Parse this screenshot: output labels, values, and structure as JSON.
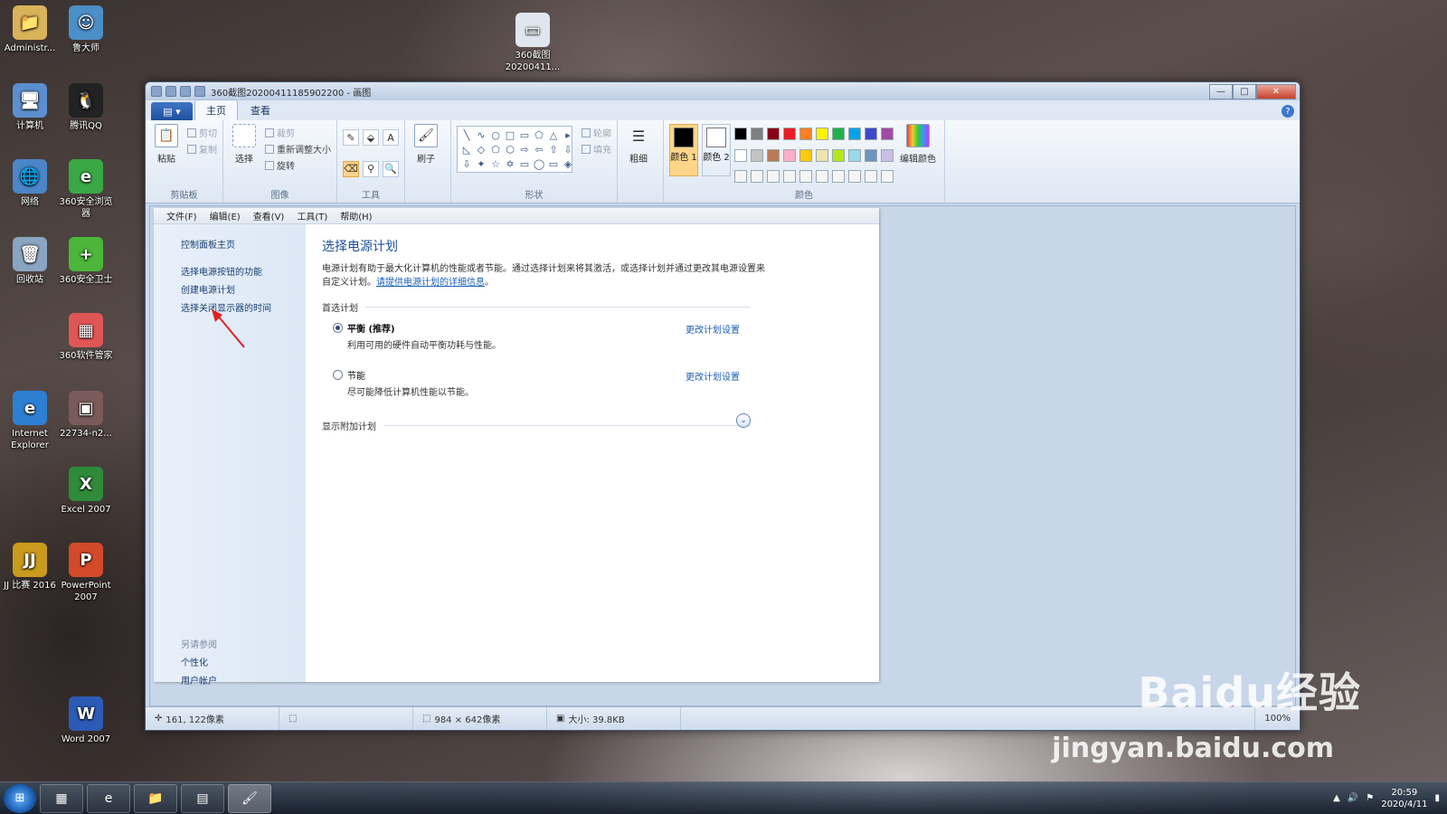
{
  "desktop_icons": [
    {
      "label": "Administr...",
      "glyph": "📁",
      "color": "#d9b35a"
    },
    {
      "label": "鲁大师",
      "glyph": "☺",
      "color": "#4b8fc8"
    },
    {
      "label": "计算机",
      "glyph": "🖥",
      "color": "#5c8fcf"
    },
    {
      "label": "腾讯QQ",
      "glyph": "🐧",
      "color": "#222"
    },
    {
      "label": "网络",
      "glyph": "🌐",
      "color": "#4b86c8"
    },
    {
      "label": "360安全浏览器",
      "glyph": "e",
      "color": "#3aa845"
    },
    {
      "label": "回收站",
      "glyph": "🗑",
      "color": "#8aa5c2"
    },
    {
      "label": "360安全卫士",
      "glyph": "+",
      "color": "#4bb63a"
    },
    {
      "label": "360软件管家",
      "glyph": "▦",
      "color": "#e05656"
    },
    {
      "label": "Internet Explorer",
      "glyph": "e",
      "color": "#2d7fd3"
    },
    {
      "label": "22734-n2...",
      "glyph": "▣",
      "color": "#7a5a5a"
    },
    {
      "label": "Excel 2007",
      "glyph": "X",
      "color": "#2f8a3a"
    },
    {
      "label": "JJ 比赛 2016",
      "glyph": "JJ",
      "color": "#c99a1c"
    },
    {
      "label": "PowerPoint 2007",
      "glyph": "P",
      "color": "#d24a2a"
    },
    {
      "label": "Word 2007",
      "glyph": "W",
      "color": "#2c5bb5"
    },
    {
      "label": "360截图 20200411...",
      "glyph": "▭",
      "color": "#dfe6ee"
    }
  ],
  "window": {
    "title": "360截图20200411185902200 - 画图",
    "controls": {
      "minimize": "—",
      "maximize": "□",
      "close": "✕"
    }
  },
  "ribbon": {
    "app_button": "▤ ▾",
    "tabs": [
      "主页",
      "查看"
    ],
    "help": "?",
    "clipboard": {
      "label": "剪贴板",
      "paste": "粘贴",
      "cut": "剪切",
      "copy": "复制"
    },
    "image": {
      "label": "图像",
      "select": "选择",
      "crop": "裁剪",
      "resize": "重新调整大小",
      "rotate": "旋转"
    },
    "tools": {
      "label": "工具",
      "icons": [
        "✎",
        "⬙",
        "A",
        "⌫",
        "⚲",
        "🔍"
      ]
    },
    "brushes": {
      "label": "刷子"
    },
    "shapes": {
      "label": "形状",
      "glyphs": [
        "╲",
        "∿",
        "○",
        "□",
        "▭",
        "⬠",
        "△",
        "▸",
        "◺",
        "◇",
        "⬠",
        "⬡",
        "⇨",
        "⇦",
        "⇧",
        "⇩",
        "⇩",
        "✦",
        "☆",
        "✡",
        "▭",
        "◯",
        "▭",
        "◈"
      ],
      "outline": "轮廓",
      "fill": "填充"
    },
    "size": {
      "label": "粗细"
    },
    "colors": {
      "label": "颜色",
      "color1": "颜色 1",
      "color2": "颜色 2",
      "edit": "编辑颜色",
      "color1_value": "#000000",
      "color2_value": "#ffffff",
      "palette": [
        "#000000",
        "#7f7f7f",
        "#880015",
        "#ed1c24",
        "#ff7f27",
        "#fff200",
        "#22b14c",
        "#00a2e8",
        "#3f48cc",
        "#a349a4",
        "#ffffff",
        "#c3c3c3",
        "#b97a57",
        "#ffaec9",
        "#ffc90e",
        "#efe4b0",
        "#b5e61d",
        "#99d9ea",
        "#7092be",
        "#c8bfe7",
        "#f5f5f5",
        "#f5f5f5",
        "#f5f5f5",
        "#f5f5f5",
        "#f5f5f5",
        "#f5f5f5",
        "#f5f5f5",
        "#f5f5f5",
        "#f5f5f5",
        "#f5f5f5"
      ]
    }
  },
  "canvas": {
    "menu": [
      "文件(F)",
      "编辑(E)",
      "查看(V)",
      "工具(T)",
      "帮助(H)"
    ],
    "sidebar": {
      "links": [
        "控制面板主页",
        "选择电源按钮的功能",
        "创建电源计划",
        "选择关闭显示器的时间"
      ],
      "see_also": "另请参阅",
      "bottom_links": [
        "个性化",
        "用户帐户"
      ]
    },
    "main": {
      "title": "选择电源计划",
      "desc": "电源计划有助于最大化计算机的性能或者节能。通过选择计划来将其激活，或选择计划并通过更改其电源设置来自定义计划。",
      "desc_link": "请提供电源计划的详细信息",
      "section_pref": "首选计划",
      "plans": [
        {
          "name": "平衡 (推荐)",
          "desc": "利用可用的硬件自动平衡功耗与性能。",
          "selected": true,
          "change": "更改计划设置"
        },
        {
          "name": "节能",
          "desc": "尽可能降低计算机性能以节能。",
          "selected": false,
          "change": "更改计划设置"
        }
      ],
      "section_more": "显示附加计划",
      "expand_icon": "⌄"
    }
  },
  "status": {
    "cursor": "161, 122像素",
    "size": "984 × 642像素",
    "file_size": "大小: 39.8KB",
    "zoom": "100%"
  },
  "taskbar": {
    "time": "20:59",
    "date": "2020/4/11"
  },
  "watermark": {
    "line1": "Baidu经验",
    "line2": "jingyan.baidu.com"
  }
}
